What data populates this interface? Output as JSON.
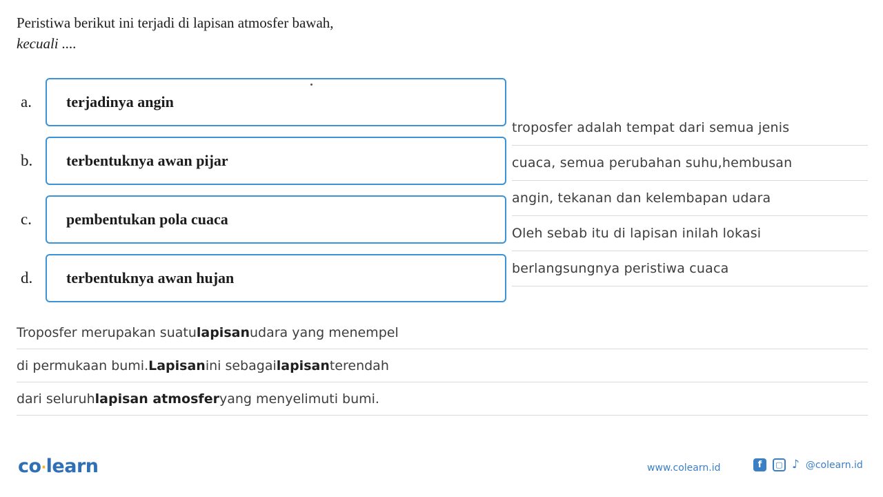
{
  "question": {
    "line1": "Peristiwa berikut ini terjadi di lapisan atmosfer bawah,",
    "line2": "kecuali ...."
  },
  "options": [
    {
      "letter": "a.",
      "text": "terjadinya angin"
    },
    {
      "letter": "b.",
      "text": "terbentuknya awan pijar"
    },
    {
      "letter": "c.",
      "text": "pembentukan pola cuaca"
    },
    {
      "letter": "d.",
      "text": "terbentuknya awan hujan"
    }
  ],
  "right_notes": [
    "troposfer adalah tempat dari semua jenis",
    "cuaca, semua perubahan suhu,hembusan",
    "angin, tekanan dan kelembapan udara",
    "Oleh sebab itu di lapisan inilah lokasi",
    "berlangsungnya peristiwa cuaca"
  ],
  "bottom_notes": [
    [
      {
        "t": "Troposfer merupakan suatu ",
        "b": false
      },
      {
        "t": "lapisan",
        "b": true
      },
      {
        "t": " udara yang menempel",
        "b": false
      }
    ],
    [
      {
        "t": "di permukaan bumi. ",
        "b": false
      },
      {
        "t": "Lapisan",
        "b": true
      },
      {
        "t": " ini sebagai ",
        "b": false
      },
      {
        "t": "lapisan",
        "b": true
      },
      {
        "t": " terendah",
        "b": false
      }
    ],
    [
      {
        "t": "dari seluruh ",
        "b": false
      },
      {
        "t": "lapisan atmosfer",
        "b": true
      },
      {
        "t": " yang menyelimuti bumi.",
        "b": false
      }
    ]
  ],
  "footer": {
    "logo_first": "co",
    "logo_dot": "·",
    "logo_second": "learn",
    "url": "www.colearn.id",
    "facebook_glyph": "f",
    "instagram_glyph": "▢",
    "tiktok_glyph": "♪",
    "handle": "@colearn.id"
  },
  "colors": {
    "option_border": "#3a92d8",
    "brand_blue": "#2f6fb5",
    "brand_yellow": "#f3b21b",
    "rule_gray": "#d9d9d9"
  }
}
